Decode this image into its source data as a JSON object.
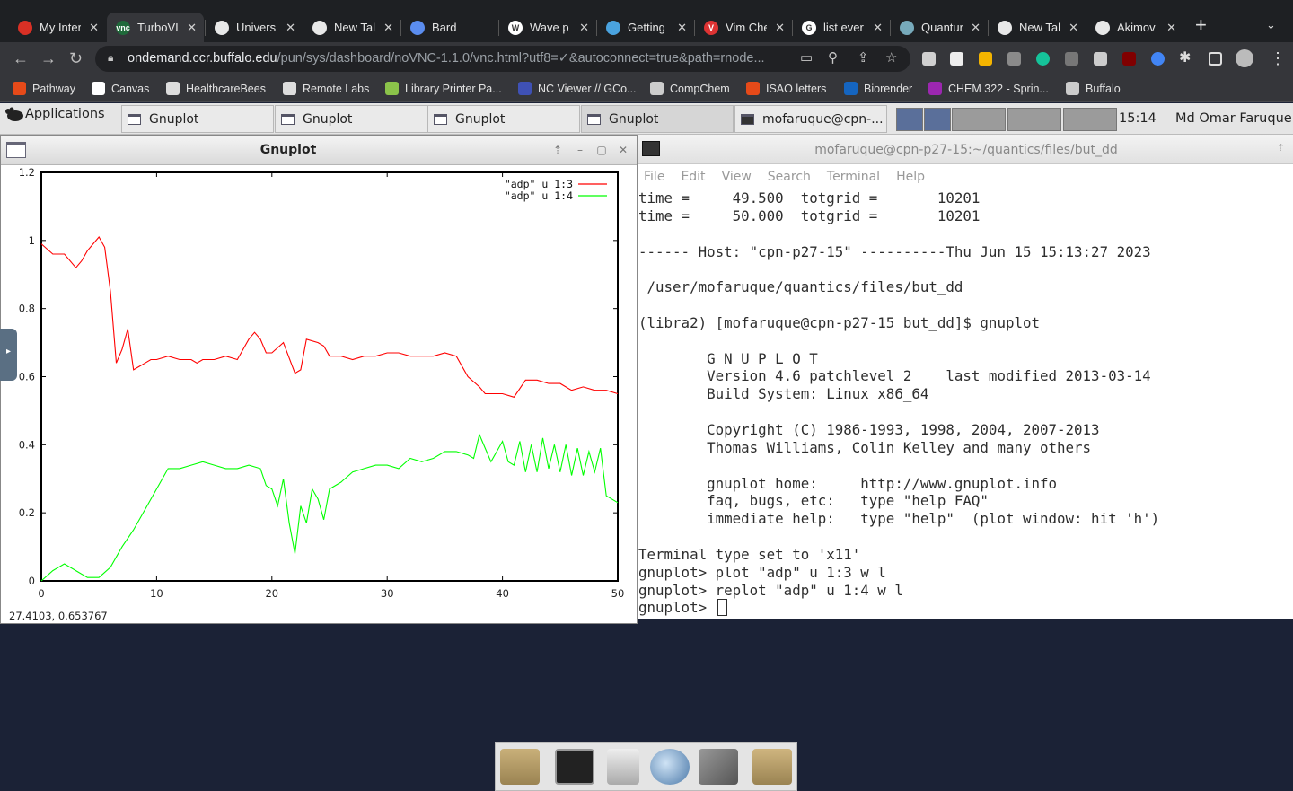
{
  "browser": {
    "tabs": [
      {
        "label": "My Inter",
        "color": "#d93025",
        "glyph": ""
      },
      {
        "label": "TurboVI",
        "color": "#1f6a3a",
        "glyph": "vnc"
      },
      {
        "label": "Univers",
        "color": "#e8e8e8",
        "glyph": ""
      },
      {
        "label": "New Tal",
        "color": "#e8e8e8",
        "glyph": ""
      },
      {
        "label": "Bard",
        "color": "#5b8def",
        "glyph": ""
      },
      {
        "label": "Wave p",
        "color": "#ffffff",
        "glyph": "W"
      },
      {
        "label": "Getting",
        "color": "#4aa3df",
        "glyph": ""
      },
      {
        "label": "Vim Che",
        "color": "#d33",
        "glyph": "V"
      },
      {
        "label": "list ever",
        "color": "#ffffff",
        "glyph": "G"
      },
      {
        "label": "Quantur",
        "color": "#7ab",
        "glyph": ""
      },
      {
        "label": "New Tal",
        "color": "#e8e8e8",
        "glyph": ""
      },
      {
        "label": "Akimov",
        "color": "#e8e8e8",
        "glyph": ""
      }
    ],
    "tab_close": "✕",
    "new_tab": "+",
    "url_host": "ondemand.ccr.buffalo.edu",
    "url_path": "/pun/sys/dashboard/noVNC-1.1.0/vnc.html?utf8=✓&autoconnect=true&path=rnode...",
    "bookmarks": [
      {
        "label": "Pathway",
        "color": "#e64a19"
      },
      {
        "label": "Canvas",
        "color": "#ffffff"
      },
      {
        "label": "HealthcareBees",
        "color": "#dddddd"
      },
      {
        "label": "Remote Labs",
        "color": "#dddddd"
      },
      {
        "label": "Library Printer Pa...",
        "color": "#8bc34a"
      },
      {
        "label": "NC Viewer // GCo...",
        "color": "#3f51b5"
      },
      {
        "label": "CompChem",
        "color": "#cccccc"
      },
      {
        "label": "ISAO letters",
        "color": "#e64a19"
      },
      {
        "label": "Biorender",
        "color": "#1565c0"
      },
      {
        "label": "CHEM 322 - Sprin...",
        "color": "#9c27b0"
      },
      {
        "label": "Buffalo",
        "color": "#cccccc"
      }
    ]
  },
  "panel": {
    "apps_label": "Applications",
    "window_buttons": [
      "Gnuplot",
      "Gnuplot",
      "Gnuplot",
      "Gnuplot",
      "mofaruque@cpn-..."
    ],
    "clock": "15:14",
    "user": "Md Omar Faruque"
  },
  "gnuplot_window": {
    "title": "Gnuplot",
    "status": "27.4103,   0.653767"
  },
  "chart_data": {
    "type": "line",
    "xlim": [
      0,
      50
    ],
    "ylim": [
      0,
      1.2
    ],
    "xticks": [
      "0",
      "10",
      "20",
      "30",
      "40",
      "50"
    ],
    "yticks": [
      "0",
      "0.2",
      "0.4",
      "0.6",
      "0.8",
      "1",
      "1.2"
    ],
    "legend_position": "top-right",
    "series": [
      {
        "name": "\"adp\" u 1:3",
        "color": "#ff0000",
        "x": [
          0,
          1,
          2,
          3,
          3.5,
          4,
          5,
          5.5,
          6,
          6.5,
          7,
          7.5,
          8,
          8.5,
          9,
          9.5,
          10,
          11,
          12,
          13,
          13.5,
          14,
          15,
          16,
          17,
          18,
          18.5,
          19,
          19.5,
          20,
          21,
          22,
          22.5,
          23,
          24,
          24.5,
          25,
          26,
          27,
          28,
          29,
          30,
          31,
          32,
          33,
          34,
          35,
          36,
          37,
          38,
          38.5,
          39,
          40,
          41,
          42,
          43,
          44,
          45,
          46,
          47,
          48,
          49,
          50
        ],
        "y": [
          0.99,
          0.96,
          0.96,
          0.92,
          0.94,
          0.97,
          1.01,
          0.98,
          0.85,
          0.64,
          0.68,
          0.74,
          0.62,
          0.63,
          0.64,
          0.65,
          0.65,
          0.66,
          0.65,
          0.65,
          0.64,
          0.65,
          0.65,
          0.66,
          0.65,
          0.71,
          0.73,
          0.71,
          0.67,
          0.67,
          0.7,
          0.61,
          0.62,
          0.71,
          0.7,
          0.69,
          0.66,
          0.66,
          0.65,
          0.66,
          0.66,
          0.67,
          0.67,
          0.66,
          0.66,
          0.66,
          0.67,
          0.66,
          0.6,
          0.57,
          0.55,
          0.55,
          0.55,
          0.54,
          0.59,
          0.59,
          0.58,
          0.58,
          0.56,
          0.57,
          0.56,
          0.56,
          0.55
        ]
      },
      {
        "name": "\"adp\" u 1:4",
        "color": "#00ff00",
        "x": [
          0,
          1,
          2,
          3,
          4,
          5,
          6,
          7,
          8,
          9,
          10,
          11,
          12,
          13,
          14,
          15,
          16,
          17,
          18,
          19,
          19.5,
          20,
          20.5,
          21,
          21.5,
          22,
          22.5,
          23,
          23.5,
          24,
          24.5,
          25,
          26,
          27,
          28,
          29,
          30,
          31,
          32,
          33,
          34,
          35,
          36,
          37,
          37.5,
          38,
          38.5,
          39,
          40,
          40.5,
          41,
          41.5,
          42,
          42.5,
          43,
          43.5,
          44,
          44.5,
          45,
          45.5,
          46,
          46.5,
          47,
          47.5,
          48,
          48.5,
          49,
          50
        ],
        "y": [
          0,
          0.03,
          0.05,
          0.03,
          0.01,
          0.01,
          0.04,
          0.1,
          0.15,
          0.21,
          0.27,
          0.33,
          0.33,
          0.34,
          0.35,
          0.34,
          0.33,
          0.33,
          0.34,
          0.33,
          0.28,
          0.27,
          0.22,
          0.3,
          0.17,
          0.08,
          0.22,
          0.17,
          0.27,
          0.24,
          0.18,
          0.27,
          0.29,
          0.32,
          0.33,
          0.34,
          0.34,
          0.33,
          0.36,
          0.35,
          0.36,
          0.38,
          0.38,
          0.37,
          0.36,
          0.43,
          0.39,
          0.35,
          0.41,
          0.35,
          0.34,
          0.41,
          0.32,
          0.4,
          0.32,
          0.42,
          0.33,
          0.4,
          0.32,
          0.4,
          0.31,
          0.39,
          0.31,
          0.38,
          0.32,
          0.39,
          0.25,
          0.23
        ]
      }
    ]
  },
  "terminal": {
    "title": "mofaruque@cpn-p27-15:~/quantics/files/but_dd",
    "menu": [
      "File",
      "Edit",
      "View",
      "Search",
      "Terminal",
      "Help"
    ],
    "lines": [
      "time =     49.500  totgrid =       10201",
      "time =     50.000  totgrid =       10201",
      "",
      "------ Host: \"cpn-p27-15\" ----------Thu Jun 15 15:13:27 2023",
      "",
      " /user/mofaruque/quantics/files/but_dd",
      "",
      "(libra2) [mofaruque@cpn-p27-15 but_dd]$ gnuplot",
      "",
      "        G N U P L O T",
      "        Version 4.6 patchlevel 2    last modified 2013-03-14",
      "        Build System: Linux x86_64",
      "",
      "        Copyright (C) 1986-1993, 1998, 2004, 2007-2013",
      "        Thomas Williams, Colin Kelley and many others",
      "",
      "        gnuplot home:     http://www.gnuplot.info",
      "        faq, bugs, etc:   type \"help FAQ\"",
      "        immediate help:   type \"help\"  (plot window: hit 'h')",
      "",
      "Terminal type set to 'x11'",
      "gnuplot> plot \"adp\" u 1:3 w l",
      "gnuplot> replot \"adp\" u 1:4 w l"
    ],
    "prompt": "gnuplot> "
  }
}
